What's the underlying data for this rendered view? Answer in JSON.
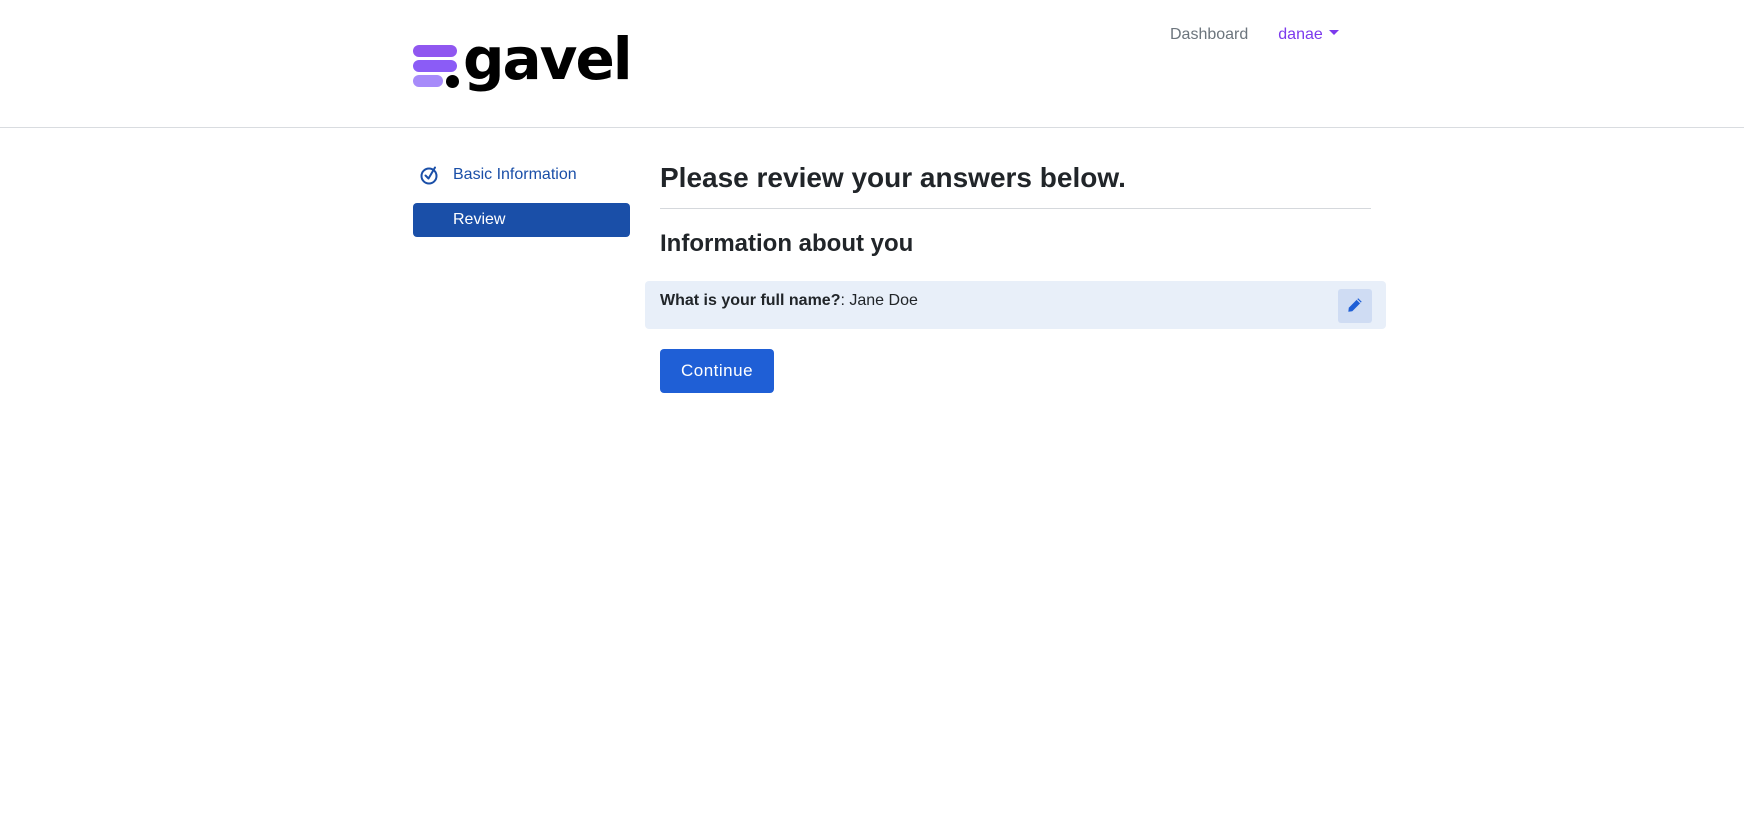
{
  "header": {
    "logo_text": "gavel",
    "nav": {
      "dashboard_label": "Dashboard",
      "user_label": "danae"
    }
  },
  "sidebar": {
    "items": [
      {
        "label": "Basic Information",
        "state": "done",
        "icon": "check-circle-icon"
      },
      {
        "label": "Review",
        "state": "active",
        "icon": ""
      }
    ]
  },
  "main": {
    "title": "Please review your answers below.",
    "section_title": "Information about you",
    "answers": [
      {
        "question": "What is your full name?",
        "separator": ":",
        "answer": " Jane Doe",
        "edit_icon": "pencil-icon"
      }
    ],
    "continue_label": "Continue"
  },
  "colors": {
    "brand_purple": "#8b5cf6",
    "primary_blue": "#1f5fd6",
    "sidebar_active": "#1a4fa8",
    "answer_row_bg": "#e8eff9"
  }
}
